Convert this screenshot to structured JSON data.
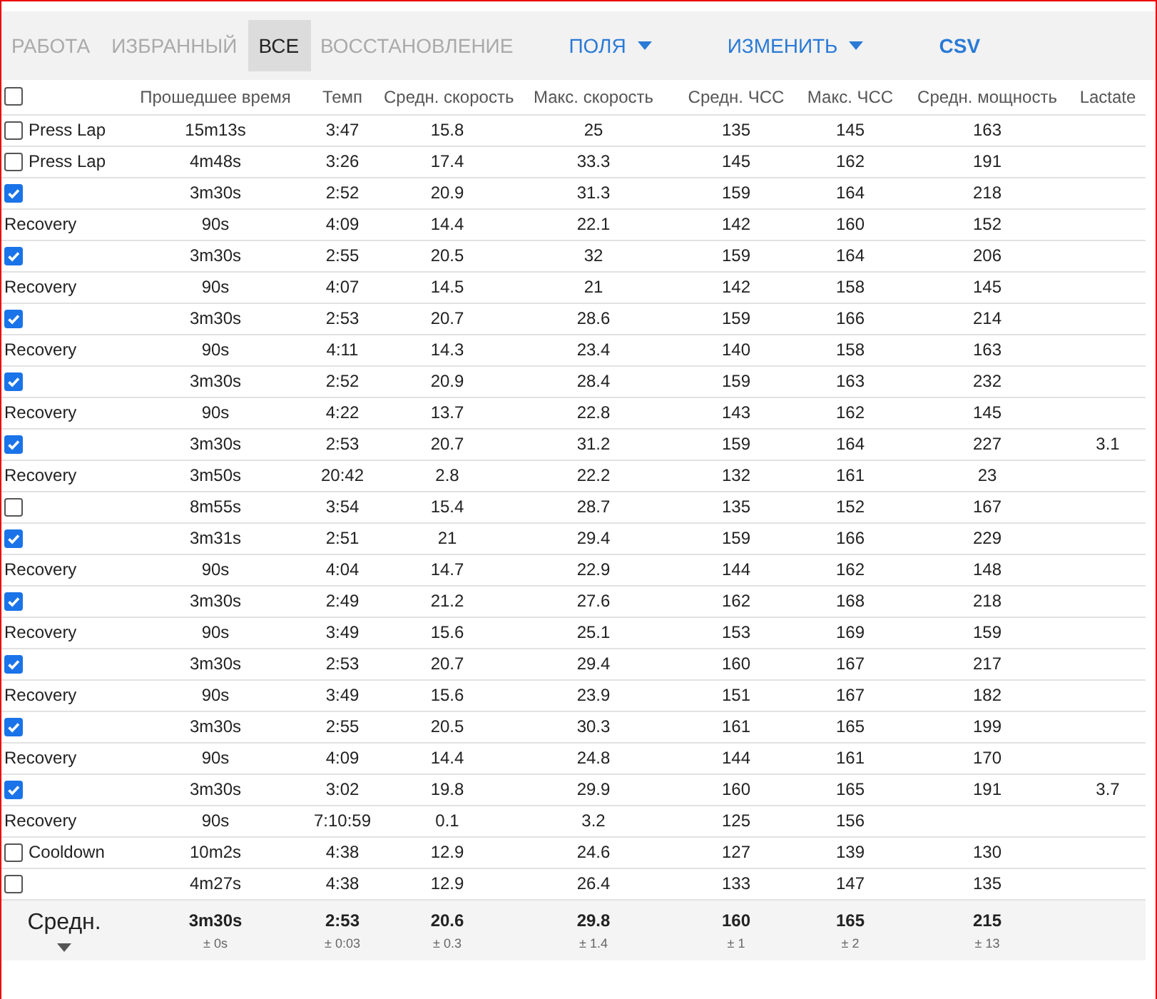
{
  "toolbar": [
    {
      "kind": "tab",
      "label": "РАБОТА",
      "selected": false
    },
    {
      "kind": "tab",
      "label": "ИЗБРАННЫЙ",
      "selected": false
    },
    {
      "kind": "tab",
      "label": "ВСЕ",
      "selected": true
    },
    {
      "kind": "tab",
      "label": "ВОССТАНОВЛЕНИЕ",
      "selected": false
    },
    {
      "kind": "dropdown",
      "label": "ПОЛЯ"
    },
    {
      "kind": "dropdown",
      "label": "ИЗМЕНИТЬ"
    },
    {
      "kind": "button",
      "label": "CSV"
    }
  ],
  "table": {
    "select_all": {
      "checked": false
    },
    "columns": [
      "Прошедшее время",
      "Темп",
      "Средн. скорость",
      "Макс. скорость",
      "Средн. ЧСС",
      "Макс. ЧСС",
      "Средн. мощность",
      "Lactate"
    ],
    "rows": [
      {
        "kind": "checkbox",
        "checked": false,
        "label": "Press Lap",
        "cells": [
          "15m13s",
          "3:47",
          "15.8",
          "25",
          "135",
          "145",
          "163"
        ]
      },
      {
        "kind": "checkbox",
        "checked": false,
        "label": "Press Lap",
        "cells": [
          "4m48s",
          "3:26",
          "17.4",
          "33.3",
          "145",
          "162",
          "191"
        ]
      },
      {
        "kind": "checkbox",
        "checked": true,
        "cells": [
          "3m30s",
          "2:52",
          "20.9",
          "31.3",
          "159",
          "164",
          "218"
        ]
      },
      {
        "kind": "plain",
        "label": "Recovery",
        "cells": [
          "90s",
          "4:09",
          "14.4",
          "22.1",
          "142",
          "160",
          "152"
        ]
      },
      {
        "kind": "checkbox",
        "checked": true,
        "cells": [
          "3m30s",
          "2:55",
          "20.5",
          "32",
          "159",
          "164",
          "206"
        ]
      },
      {
        "kind": "plain",
        "label": "Recovery",
        "cells": [
          "90s",
          "4:07",
          "14.5",
          "21",
          "142",
          "158",
          "145"
        ]
      },
      {
        "kind": "checkbox",
        "checked": true,
        "cells": [
          "3m30s",
          "2:53",
          "20.7",
          "28.6",
          "159",
          "166",
          "214"
        ]
      },
      {
        "kind": "plain",
        "label": "Recovery",
        "cells": [
          "90s",
          "4:11",
          "14.3",
          "23.4",
          "140",
          "158",
          "163"
        ]
      },
      {
        "kind": "checkbox",
        "checked": true,
        "cells": [
          "3m30s",
          "2:52",
          "20.9",
          "28.4",
          "159",
          "163",
          "232"
        ]
      },
      {
        "kind": "plain",
        "label": "Recovery",
        "cells": [
          "90s",
          "4:22",
          "13.7",
          "22.8",
          "143",
          "162",
          "145"
        ]
      },
      {
        "kind": "checkbox",
        "checked": true,
        "cells": [
          "3m30s",
          "2:53",
          "20.7",
          "31.2",
          "159",
          "164",
          "227",
          "3.1"
        ]
      },
      {
        "kind": "plain",
        "label": "Recovery",
        "cells": [
          "3m50s",
          "20:42",
          "2.8",
          "22.2",
          "132",
          "161",
          "23"
        ]
      },
      {
        "kind": "checkbox",
        "checked": false,
        "cells": [
          "8m55s",
          "3:54",
          "15.4",
          "28.7",
          "135",
          "152",
          "167"
        ]
      },
      {
        "kind": "checkbox",
        "checked": true,
        "cells": [
          "3m31s",
          "2:51",
          "21",
          "29.4",
          "159",
          "166",
          "229"
        ]
      },
      {
        "kind": "plain",
        "label": "Recovery",
        "cells": [
          "90s",
          "4:04",
          "14.7",
          "22.9",
          "144",
          "162",
          "148"
        ]
      },
      {
        "kind": "checkbox",
        "checked": true,
        "cells": [
          "3m30s",
          "2:49",
          "21.2",
          "27.6",
          "162",
          "168",
          "218"
        ]
      },
      {
        "kind": "plain",
        "label": "Recovery",
        "cells": [
          "90s",
          "3:49",
          "15.6",
          "25.1",
          "153",
          "169",
          "159"
        ]
      },
      {
        "kind": "checkbox",
        "checked": true,
        "cells": [
          "3m30s",
          "2:53",
          "20.7",
          "29.4",
          "160",
          "167",
          "217"
        ]
      },
      {
        "kind": "plain",
        "label": "Recovery",
        "cells": [
          "90s",
          "3:49",
          "15.6",
          "23.9",
          "151",
          "167",
          "182"
        ]
      },
      {
        "kind": "checkbox",
        "checked": true,
        "cells": [
          "3m30s",
          "2:55",
          "20.5",
          "30.3",
          "161",
          "165",
          "199"
        ]
      },
      {
        "kind": "plain",
        "label": "Recovery",
        "cells": [
          "90s",
          "4:09",
          "14.4",
          "24.8",
          "144",
          "161",
          "170"
        ]
      },
      {
        "kind": "checkbox",
        "checked": true,
        "cells": [
          "3m30s",
          "3:02",
          "19.8",
          "29.9",
          "160",
          "165",
          "191",
          "3.7"
        ]
      },
      {
        "kind": "plain",
        "label": "Recovery",
        "cells": [
          "90s",
          "7:10:59",
          "0.1",
          "3.2",
          "125",
          "156"
        ]
      },
      {
        "kind": "checkbox",
        "checked": false,
        "label": "Cooldown",
        "cells": [
          "10m2s",
          "4:38",
          "12.9",
          "24.6",
          "127",
          "139",
          "130"
        ]
      },
      {
        "kind": "checkbox",
        "checked": false,
        "cells": [
          "4m27s",
          "4:38",
          "12.9",
          "26.4",
          "133",
          "147",
          "135"
        ]
      }
    ],
    "footer": {
      "label": "Средн.",
      "cells": [
        {
          "value": "3m30s",
          "spread": "± 0s"
        },
        {
          "value": "2:53",
          "spread": "± 0:03"
        },
        {
          "value": "20.6",
          "spread": "± 0.3"
        },
        {
          "value": "29.8",
          "spread": "± 1.4"
        },
        {
          "value": "160",
          "spread": "± 1"
        },
        {
          "value": "165",
          "spread": "± 2"
        },
        {
          "value": "215",
          "spread": "± 13"
        }
      ]
    }
  }
}
